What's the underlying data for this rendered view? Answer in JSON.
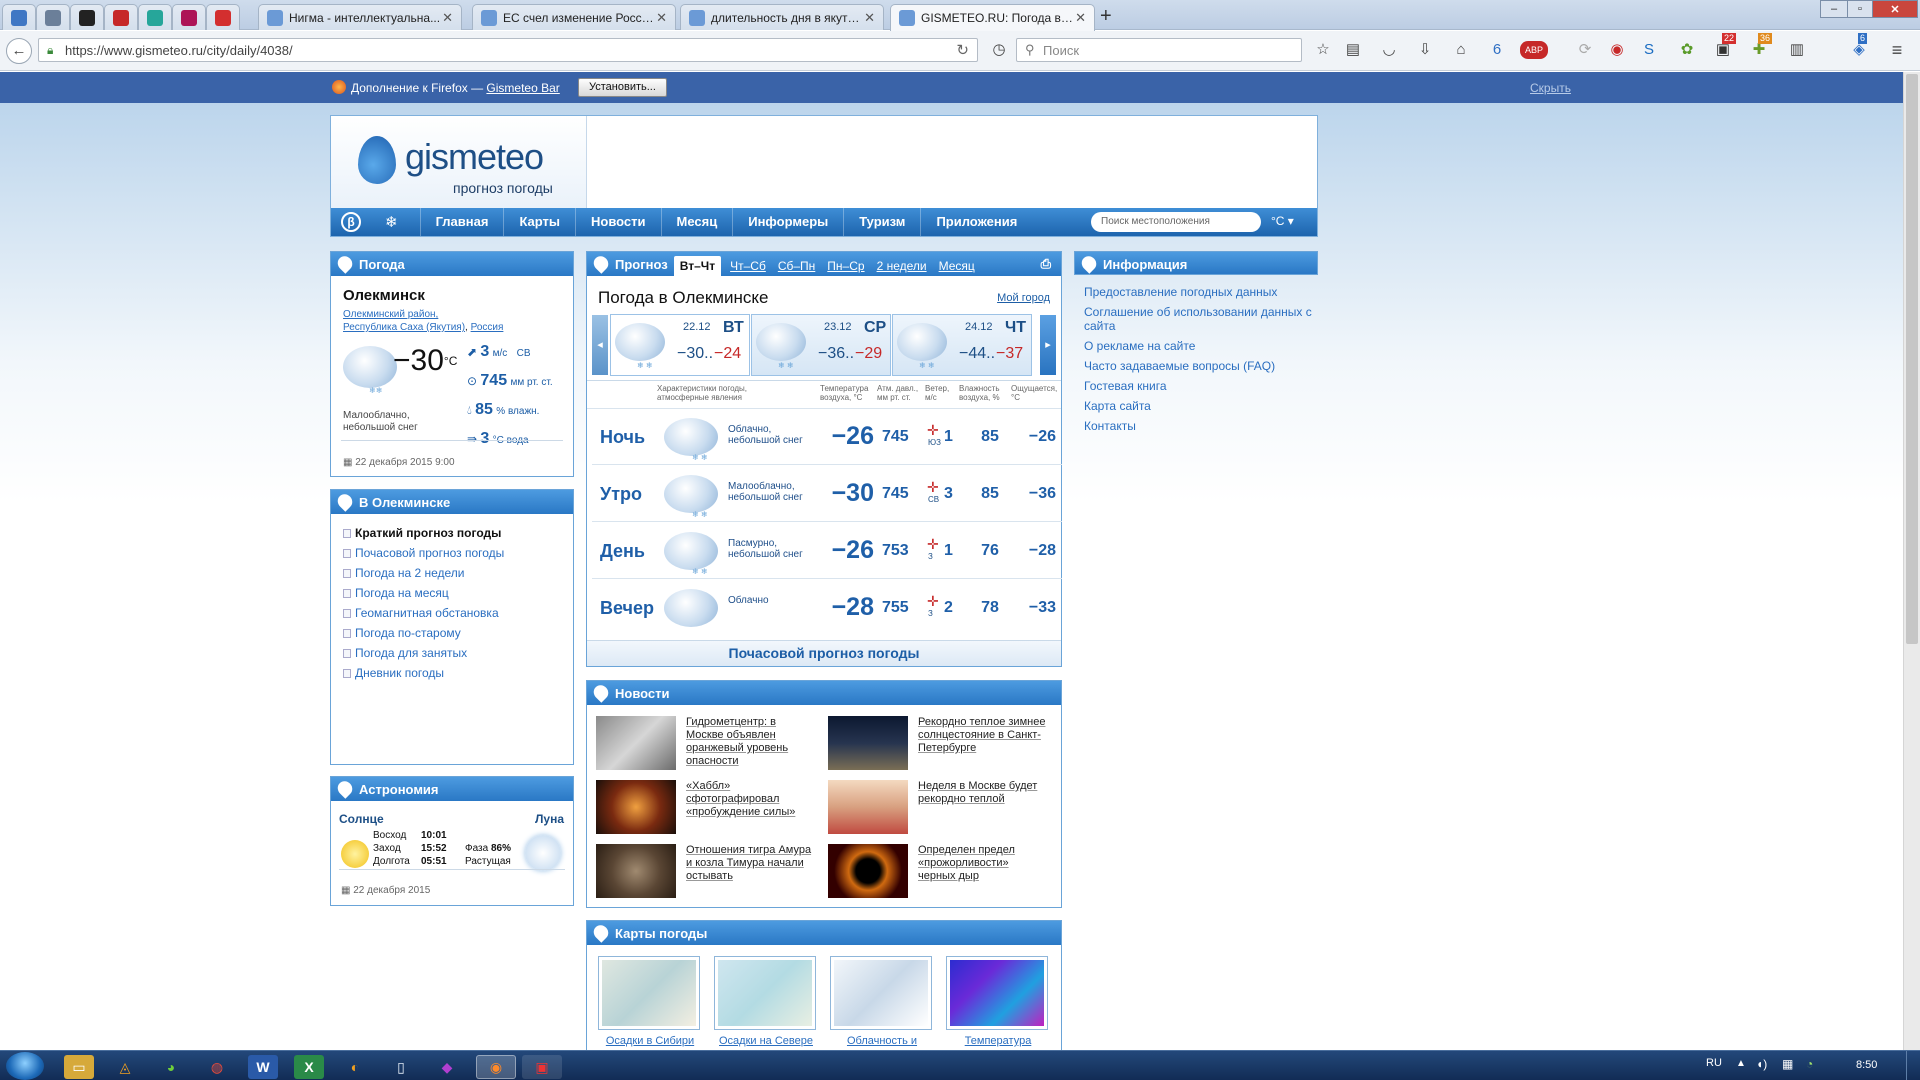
{
  "browser": {
    "tabs": [
      {
        "label": "",
        "pinned": true,
        "color": "#3f77c4"
      },
      {
        "label": "",
        "pinned": true,
        "color": "#6b7f99"
      },
      {
        "label": "",
        "pinned": true,
        "color": "#222222"
      },
      {
        "label": "",
        "pinned": true,
        "color": "#c62828"
      },
      {
        "label": "",
        "pinned": true,
        "color": "#26a69a"
      },
      {
        "label": "",
        "pinned": true,
        "color": "#ad1457"
      },
      {
        "label": "",
        "pinned": true,
        "color": "#d32f2f"
      },
      {
        "label": "Нигма - интеллектуальна...",
        "pinned": false
      },
      {
        "label": "ЕС счел изменение Росси...",
        "pinned": false
      },
      {
        "label": "длительность дня в якути...",
        "pinned": false
      },
      {
        "label": "GISMETEO.RU: Погода в О...",
        "pinned": false,
        "active": true
      }
    ],
    "new_tab": "+",
    "url": "https://www.gismeteo.ru/city/daily/4038/",
    "search_placeholder": "Поиск",
    "badges": {
      "b1": "22",
      "b2": "36",
      "b3": "6"
    }
  },
  "notification": {
    "text": "Дополнение к Firefox — ",
    "link": "Gismeteo Bar",
    "install_button": "Установить...",
    "hide_link": "Скрыть"
  },
  "site": {
    "logo_text": "gismeteo",
    "logo_sub": "прогноз погоды",
    "nav": [
      "Главная",
      "Карты",
      "Новости",
      "Месяц",
      "Информеры",
      "Туризм",
      "Приложения"
    ],
    "nav_beta": "β",
    "search_placeholder": "Поиск местоположения",
    "unit": "°C"
  },
  "weather_box": {
    "title": "Погода",
    "city": "Олекминск",
    "region": "Олекминский район,",
    "republic": "Республика Саха (Якутия)",
    "country": "Россия",
    "temp": "−30",
    "temp_unit": "°C",
    "wind_value": "3",
    "wind_unit": "м/с",
    "wind_dir": "СВ",
    "pressure_value": "745",
    "pressure_unit": "мм рт. ст.",
    "humidity_value": "85",
    "humidity_unit": "% влажн.",
    "water_value": "3",
    "water_unit": "°C вода",
    "condition": "Малооблачно, небольшой снег",
    "date": "22 декабря 2015 9:00"
  },
  "city_box": {
    "title": "В Олекминске",
    "items": [
      "Краткий прогноз погоды",
      "Почасовой прогноз погоды",
      "Погода на 2 недели",
      "Погода на месяц",
      "Геомагнитная обстановка",
      "Погода по-старому",
      "Погода для занятых",
      "Дневник погоды"
    ]
  },
  "astro_box": {
    "title": "Астрономия",
    "sun_label": "Солнце",
    "moon_label": "Луна",
    "sunrise_label": "Восход",
    "sunrise": "10:01",
    "sunset_label": "Заход",
    "sunset": "15:52",
    "length_label": "Долгота",
    "length": "05:51",
    "phase_label": "Фаза",
    "phase": "86%",
    "moon_state": "Растущая",
    "date": "22 декабря 2015"
  },
  "forecast": {
    "title": "Прогноз",
    "tabs": [
      "Вт–Чт",
      "Чт–Сб",
      "Сб–Пн",
      "Пн–Ср",
      "2 недели",
      "Месяц"
    ],
    "heading": "Погода в Олекминске",
    "my_city": "Мой город",
    "days": [
      {
        "date": "22.12",
        "dow": "ВТ",
        "min": "−30..",
        "max": "−24"
      },
      {
        "date": "23.12",
        "dow": "СР",
        "min": "−36..",
        "max": "−29"
      },
      {
        "date": "24.12",
        "dow": "ЧТ",
        "min": "−44..",
        "max": "−37"
      }
    ],
    "col_headers": {
      "conditions": "Характеристики погоды, атмосферные явления",
      "temp": "Температура воздуха, °C",
      "pressure": "Атм. давл., мм рт. ст.",
      "wind": "Ветер, м/с",
      "humidity": "Влажность воздуха, %",
      "feels": "Ощущается, °C"
    },
    "rows": [
      {
        "tod": "Ночь",
        "desc": "Облачно, небольшой снег",
        "temp": "−26",
        "pressure": "745",
        "wind": "1",
        "wind_dir": "ЮЗ",
        "humidity": "85",
        "feels": "−26"
      },
      {
        "tod": "Утро",
        "desc": "Малооблачно, небольшой снег",
        "temp": "−30",
        "pressure": "745",
        "wind": "3",
        "wind_dir": "СВ",
        "humidity": "85",
        "feels": "−36"
      },
      {
        "tod": "День",
        "desc": "Пасмурно, небольшой снег",
        "temp": "−26",
        "pressure": "753",
        "wind": "1",
        "wind_dir": "З",
        "humidity": "76",
        "feels": "−28"
      },
      {
        "tod": "Вечер",
        "desc": "Облачно",
        "temp": "−28",
        "pressure": "755",
        "wind": "2",
        "wind_dir": "З",
        "humidity": "78",
        "feels": "−33"
      }
    ],
    "hourly_link": "Почасовой прогноз погоды"
  },
  "news": {
    "title": "Новости",
    "items": [
      "Гидрометцентр: в Москве объявлен оранжевый уровень опасности",
      "Рекордно теплое зимнее солнцестояние в Санкт-Петербурге",
      "«Хаббл» сфотографировал «пробуждение силы»",
      "Неделя в Москве будет рекордно теплой",
      "Отношения тигра Амура и козла Тимура начали остывать",
      "Определен предел «прожорливости» черных дыр"
    ]
  },
  "maps": {
    "title": "Карты погоды",
    "items": [
      "Осадки в Сибири",
      "Осадки на Севере",
      "Облачность и",
      "Температура"
    ]
  },
  "info": {
    "title": "Информация",
    "links": [
      "Предоставление погодных данных",
      "Соглашение об использовании данных с сайта",
      "О рекламе на сайте",
      "Часто задаваемые вопросы (FAQ)",
      "Гостевая книга",
      "Карта сайта",
      "Контакты"
    ]
  },
  "taskbar": {
    "lang": "RU",
    "time": "8:50"
  }
}
